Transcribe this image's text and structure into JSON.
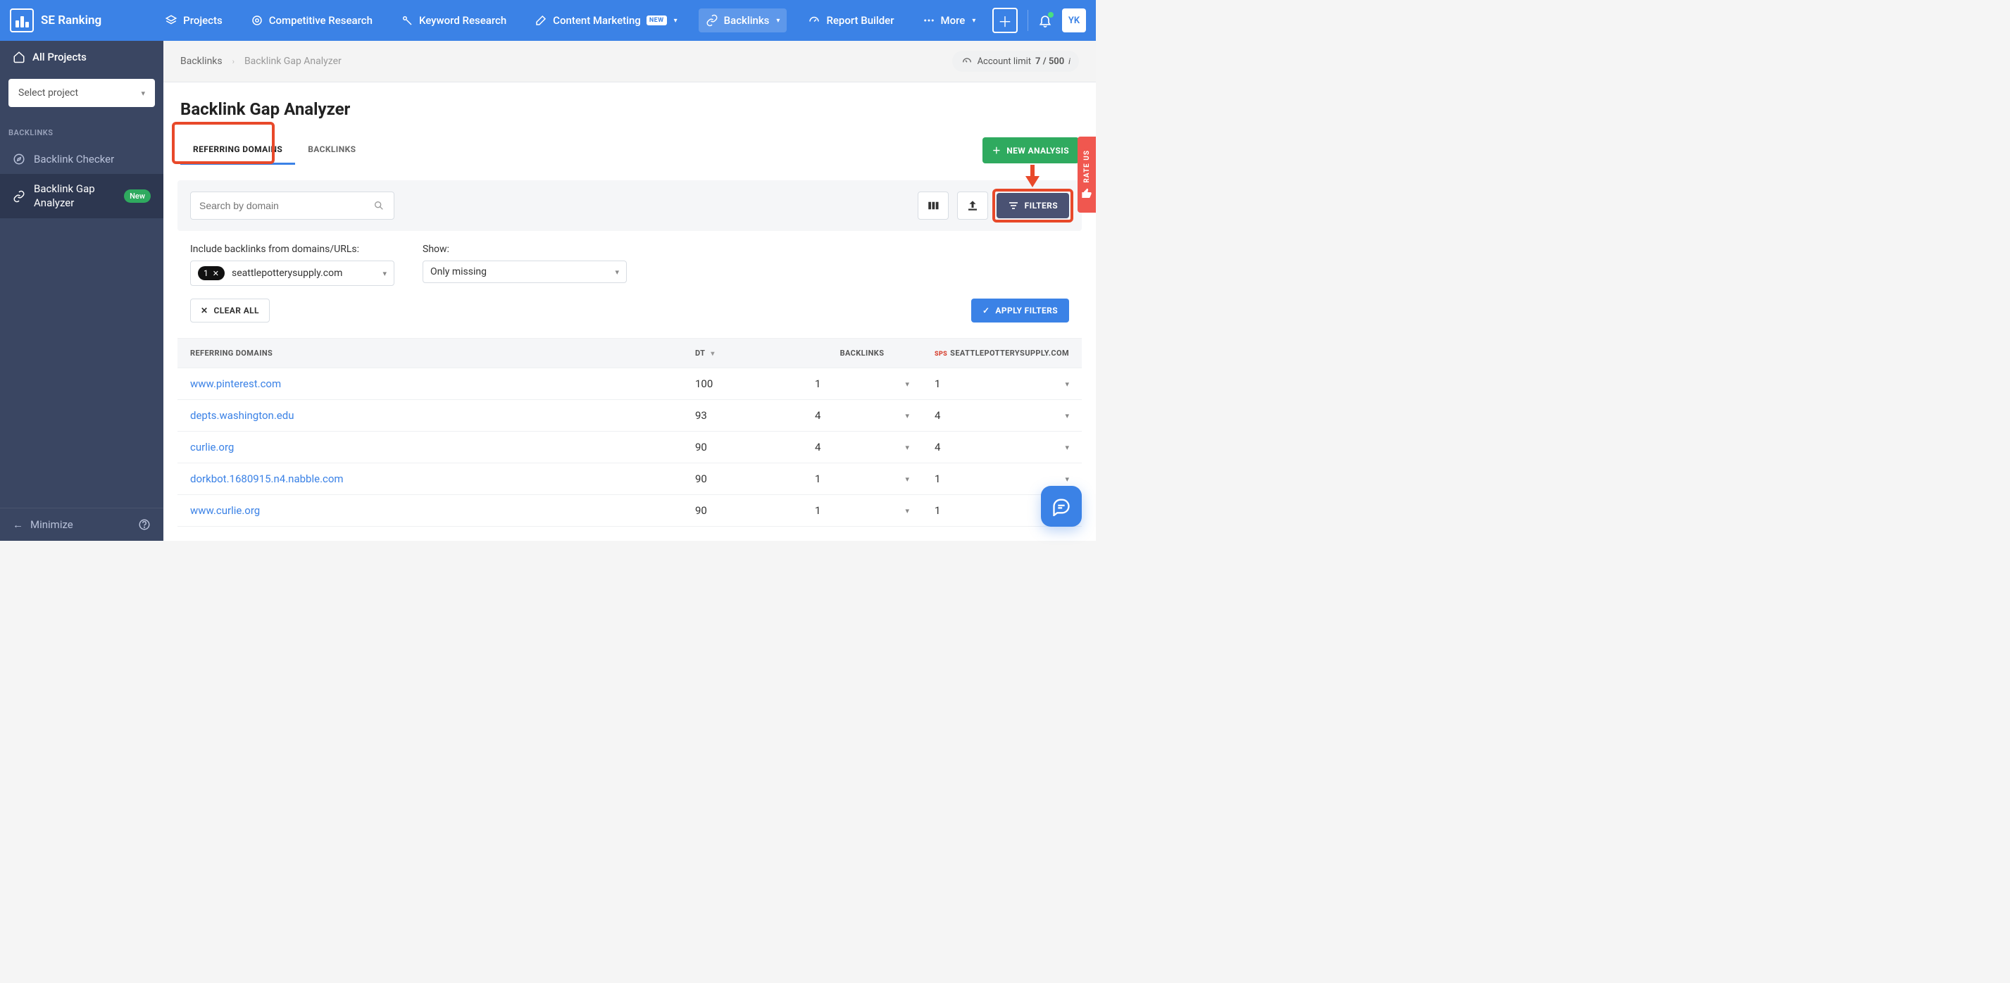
{
  "brand": "SE Ranking",
  "topnav": {
    "items": [
      {
        "label": "Projects"
      },
      {
        "label": "Competitive Research"
      },
      {
        "label": "Keyword Research"
      },
      {
        "label": "Content Marketing",
        "badge": "NEW"
      },
      {
        "label": "Backlinks"
      },
      {
        "label": "Report Builder"
      },
      {
        "label": "More"
      }
    ],
    "avatar": "YK"
  },
  "sidebar": {
    "all_projects": "All Projects",
    "select_project": "Select project",
    "heading": "BACKLINKS",
    "items": [
      {
        "label": "Backlink Checker"
      },
      {
        "label": "Backlink Gap Analyzer",
        "badge": "New"
      }
    ],
    "minimize": "Minimize"
  },
  "breadcrumb": {
    "root": "Backlinks",
    "current": "Backlink Gap Analyzer"
  },
  "account_limit": {
    "label": "Account limit",
    "value": "7 / 500"
  },
  "page": {
    "title": "Backlink Gap Analyzer",
    "tabs": [
      {
        "label": "REFERRING DOMAINS"
      },
      {
        "label": "BACKLINKS"
      }
    ],
    "new_analysis": "NEW ANALYSIS"
  },
  "toolbar": {
    "search_placeholder": "Search by domain",
    "filters": "FILTERS"
  },
  "filters": {
    "include_label": "Include backlinks from domains/URLs:",
    "chip_count": "1",
    "chip_domain": "seattlepotterysupply.com",
    "show_label": "Show:",
    "show_value": "Only missing",
    "clear": "CLEAR ALL",
    "apply": "APPLY FILTERS"
  },
  "table": {
    "headers": {
      "c1": "REFERRING DOMAINS",
      "c2": "DT",
      "c3": "BACKLINKS",
      "c4": "SEATTLEPOTTERYSUPPLY.COM",
      "c4_prefix": "SPS"
    },
    "rows": [
      {
        "domain": "www.pinterest.com",
        "dt": "100",
        "backlinks": "1",
        "target": "1"
      },
      {
        "domain": "depts.washington.edu",
        "dt": "93",
        "backlinks": "4",
        "target": "4"
      },
      {
        "domain": "curlie.org",
        "dt": "90",
        "backlinks": "4",
        "target": "4"
      },
      {
        "domain": "dorkbot.1680915.n4.nabble.com",
        "dt": "90",
        "backlinks": "1",
        "target": "1"
      },
      {
        "domain": "www.curlie.org",
        "dt": "90",
        "backlinks": "1",
        "target": "1"
      }
    ]
  },
  "rate_us": "RATE US"
}
